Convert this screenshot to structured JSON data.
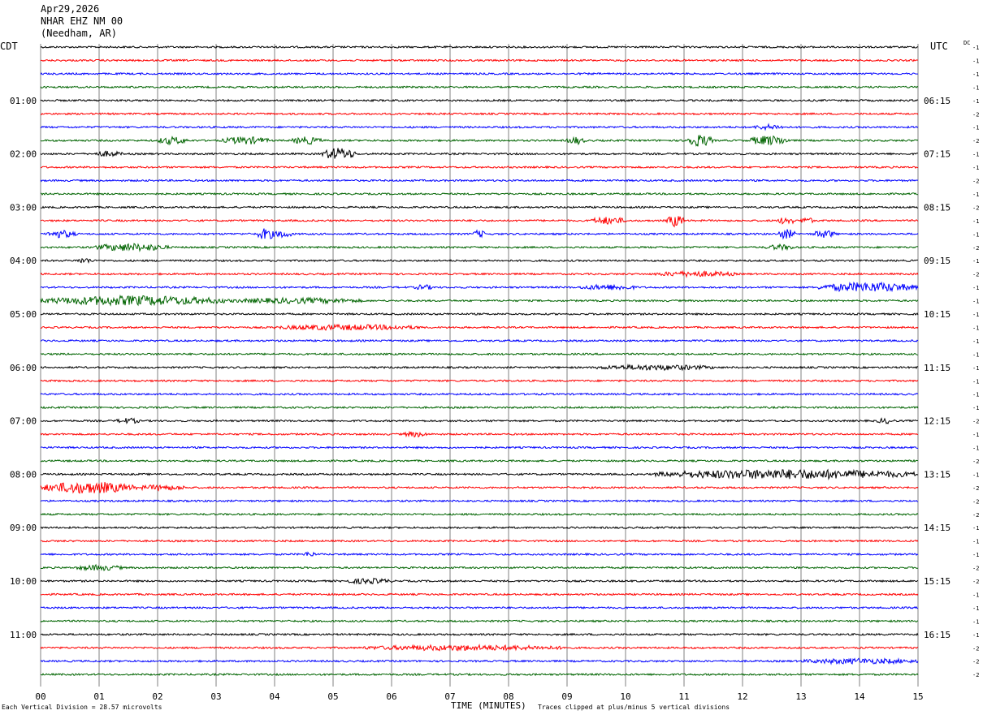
{
  "header": {
    "date": "Apr29,2026",
    "station": "NHAR EHZ NM 00",
    "location": "(Needham, AR)"
  },
  "axis_labels": {
    "left_tz": "CDT",
    "right_tz": "UTC",
    "dc": "DC",
    "xlabel": "TIME (MINUTES)"
  },
  "footer": {
    "scale_note": "Each Vertical Division =   28.57 microvolts",
    "clip_note": "Traces clipped at plus/minus 5 vertical divisions"
  },
  "colors": {
    "trace_cycle": [
      "#000000",
      "#ff0000",
      "#0000ff",
      "#006400"
    ],
    "grid": "#808080"
  },
  "chart_data": {
    "type": "line",
    "subtype": "helicorder",
    "title": "Apr29,2026 NHAR EHZ NM 00 (Needham, AR)",
    "xlabel": "TIME (MINUTES)",
    "xlim": [
      0,
      15
    ],
    "x_ticks": [
      "00",
      "01",
      "02",
      "03",
      "04",
      "05",
      "06",
      "07",
      "08",
      "09",
      "10",
      "11",
      "12",
      "13",
      "14",
      "15"
    ],
    "left_hour_labels": [
      {
        "row": 4,
        "label": "01:00"
      },
      {
        "row": 8,
        "label": "02:00"
      },
      {
        "row": 12,
        "label": "03:00"
      },
      {
        "row": 16,
        "label": "04:00"
      },
      {
        "row": 20,
        "label": "05:00"
      },
      {
        "row": 24,
        "label": "06:00"
      },
      {
        "row": 28,
        "label": "07:00"
      },
      {
        "row": 32,
        "label": "08:00"
      },
      {
        "row": 36,
        "label": "09:00"
      },
      {
        "row": 40,
        "label": "10:00"
      },
      {
        "row": 44,
        "label": "11:00"
      }
    ],
    "right_hour_labels": [
      {
        "row": 4,
        "label": "06:15"
      },
      {
        "row": 8,
        "label": "07:15"
      },
      {
        "row": 12,
        "label": "08:15"
      },
      {
        "row": 16,
        "label": "09:15"
      },
      {
        "row": 20,
        "label": "10:15"
      },
      {
        "row": 24,
        "label": "11:15"
      },
      {
        "row": 28,
        "label": "12:15"
      },
      {
        "row": 32,
        "label": "13:15"
      },
      {
        "row": 36,
        "label": "14:15"
      },
      {
        "row": 40,
        "label": "15:15"
      },
      {
        "row": 44,
        "label": "16:15"
      }
    ],
    "dc_offsets": [
      "-1",
      "-1",
      "-1",
      "-1",
      "-1",
      "-2",
      "-1",
      "-2",
      "-1",
      "-1",
      "-2",
      "-1",
      "-2",
      "-1",
      "-1",
      "-2",
      "-1",
      "-2",
      "-1",
      "-1",
      "-1",
      "-1",
      "-1",
      "-1",
      "-1",
      "-1",
      "-1",
      "-1",
      "-2",
      "-1",
      "-1",
      "-2",
      "-1",
      "-2",
      "-2",
      "-2",
      "-1",
      "-1",
      "-1",
      "-2",
      "-2",
      "-1",
      "-1",
      "-1",
      "-1",
      "-2",
      "-2",
      "-2"
    ],
    "events": [
      {
        "row": 6,
        "start_min": 12.2,
        "end_min": 12.7,
        "amp": 2
      },
      {
        "row": 7,
        "start_min": 2.0,
        "end_min": 2.5,
        "amp": 3
      },
      {
        "row": 7,
        "start_min": 3.1,
        "end_min": 3.9,
        "amp": 3
      },
      {
        "row": 7,
        "start_min": 4.3,
        "end_min": 4.8,
        "amp": 3
      },
      {
        "row": 7,
        "start_min": 9.0,
        "end_min": 9.3,
        "amp": 3
      },
      {
        "row": 7,
        "start_min": 11.0,
        "end_min": 11.5,
        "amp": 5
      },
      {
        "row": 7,
        "start_min": 12.1,
        "end_min": 12.8,
        "amp": 4
      },
      {
        "row": 8,
        "start_min": 0.9,
        "end_min": 1.4,
        "amp": 2
      },
      {
        "row": 8,
        "start_min": 4.8,
        "end_min": 5.4,
        "amp": 5
      },
      {
        "row": 13,
        "start_min": 9.4,
        "end_min": 10.0,
        "amp": 3
      },
      {
        "row": 13,
        "start_min": 10.7,
        "end_min": 11.0,
        "amp": 5
      },
      {
        "row": 13,
        "start_min": 12.6,
        "end_min": 12.9,
        "amp": 3
      },
      {
        "row": 13,
        "start_min": 13.0,
        "end_min": 13.2,
        "amp": 3
      },
      {
        "row": 14,
        "start_min": 0.1,
        "end_min": 0.6,
        "amp": 3
      },
      {
        "row": 14,
        "start_min": 3.7,
        "end_min": 4.0,
        "amp": 5
      },
      {
        "row": 14,
        "start_min": 4.0,
        "end_min": 4.3,
        "amp": 3
      },
      {
        "row": 14,
        "start_min": 7.4,
        "end_min": 7.6,
        "amp": 3
      },
      {
        "row": 14,
        "start_min": 12.6,
        "end_min": 12.9,
        "amp": 4
      },
      {
        "row": 14,
        "start_min": 13.2,
        "end_min": 13.6,
        "amp": 3
      },
      {
        "row": 15,
        "start_min": 0.9,
        "end_min": 2.2,
        "amp": 3
      },
      {
        "row": 15,
        "start_min": 12.4,
        "end_min": 12.9,
        "amp": 2
      },
      {
        "row": 16,
        "start_min": 0.6,
        "end_min": 0.9,
        "amp": 2
      },
      {
        "row": 17,
        "start_min": 10.5,
        "end_min": 11.9,
        "amp": 2
      },
      {
        "row": 18,
        "start_min": 6.4,
        "end_min": 6.7,
        "amp": 2
      },
      {
        "row": 18,
        "start_min": 9.2,
        "end_min": 10.2,
        "amp": 2
      },
      {
        "row": 18,
        "start_min": 13.3,
        "end_min": 15.0,
        "amp": 4
      },
      {
        "row": 19,
        "start_min": 0.0,
        "end_min": 3.2,
        "amp": 4
      },
      {
        "row": 19,
        "start_min": 3.2,
        "end_min": 5.5,
        "amp": 2
      },
      {
        "row": 21,
        "start_min": 4.0,
        "end_min": 6.5,
        "amp": 2
      },
      {
        "row": 24,
        "start_min": 9.5,
        "end_min": 11.5,
        "amp": 2
      },
      {
        "row": 28,
        "start_min": 1.3,
        "end_min": 1.7,
        "amp": 2
      },
      {
        "row": 28,
        "start_min": 14.3,
        "end_min": 14.6,
        "amp": 2
      },
      {
        "row": 29,
        "start_min": 6.2,
        "end_min": 6.6,
        "amp": 2
      },
      {
        "row": 32,
        "start_min": 10.5,
        "end_min": 15.0,
        "amp": 4
      },
      {
        "row": 33,
        "start_min": 0.0,
        "end_min": 1.6,
        "amp": 5
      },
      {
        "row": 33,
        "start_min": 1.6,
        "end_min": 2.5,
        "amp": 2
      },
      {
        "row": 38,
        "start_min": 4.5,
        "end_min": 4.7,
        "amp": 2
      },
      {
        "row": 39,
        "start_min": 0.6,
        "end_min": 1.4,
        "amp": 2
      },
      {
        "row": 40,
        "start_min": 5.2,
        "end_min": 6.0,
        "amp": 2
      },
      {
        "row": 45,
        "start_min": 5.5,
        "end_min": 9.0,
        "amp": 2
      },
      {
        "row": 46,
        "start_min": 13.0,
        "end_min": 15.0,
        "amp": 2
      }
    ]
  }
}
